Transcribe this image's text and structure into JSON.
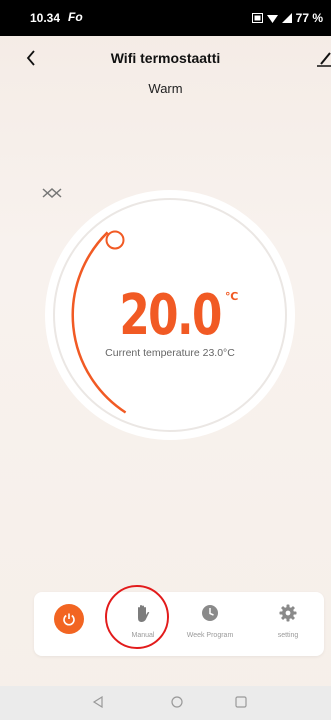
{
  "status_bar": {
    "time": "10.34",
    "app_glyph": "Fo",
    "battery": "77 %"
  },
  "header": {
    "title": "Wifi termostaatti",
    "mode": "Warm"
  },
  "dial": {
    "setpoint": "20.0",
    "unit": "℃",
    "current_label": "Current temperature 23.0°C",
    "accent_color": "#f15a24"
  },
  "tabs": [
    {
      "icon": "power-icon",
      "label": ""
    },
    {
      "icon": "hand-icon",
      "label": "Manual"
    },
    {
      "icon": "clock-icon",
      "label": "Week Program"
    },
    {
      "icon": "gear-icon",
      "label": "setting"
    }
  ]
}
